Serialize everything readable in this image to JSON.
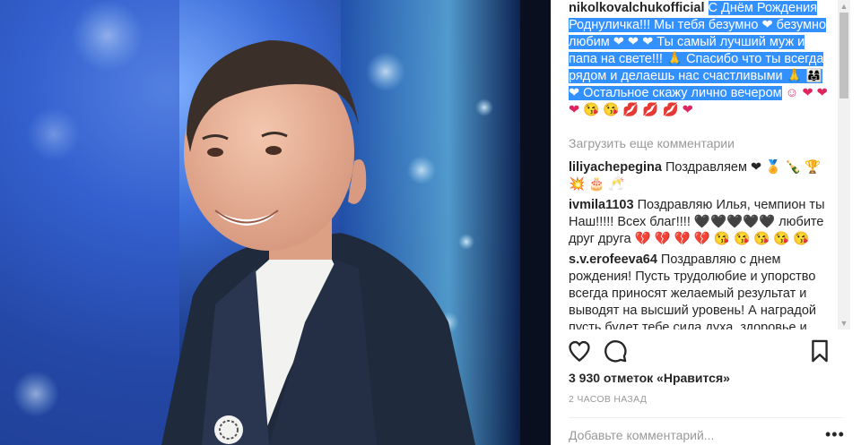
{
  "post": {
    "author": "nikolkovalchukofficial",
    "caption_selected": "С Днём Рождения Роднуличка!!! Мы тебя безумно ❤ безумно любим ❤ ❤ ❤ Ты самый лучший муж и папа на свете!!! 🙏 Спасибо что ты всегда рядом и делаешь нас счастливыми 🙏 👨‍👩‍👧 ❤ Остальное скажу лично вечером",
    "caption_tail": "☺ ❤ ❤ ❤ 😘 😘 💋 💋 💋 ❤"
  },
  "load_more": "Загрузить еще комментарии",
  "comments": [
    {
      "user": "liliyachepegina",
      "text": "Поздравляем ❤ 🏅 🍾 🏆 💥 🎂 🥂"
    },
    {
      "user": "ivmila1103",
      "text": "Поздравляю Илья, чемпион ты Наш!!!!! Всех благ!!!! 🖤🖤🖤🖤🖤 любите друг друга 💔 💔 💔 💔 😘 😘 😘 😘 😘"
    },
    {
      "user": "s.v.erofeeva64",
      "text": "Поздравляю с днем рождения! Пусть трудолюбие и упорство всегда приносят желаемый результат и выводят на высший уровень! А наградой пусть будет тебе сила духа ,здоровье и"
    }
  ],
  "likes": "3 930 отметок «Нравится»",
  "timestamp": "2 ЧАСОВ НАЗАД",
  "add_comment_placeholder": "Добавьте комментарий...",
  "more_label": "•••",
  "icons": {
    "like": "heart-icon",
    "comment": "comment-bubble-icon",
    "save": "bookmark-icon",
    "more": "more-options-icon",
    "scroll_up": "scroll-up-arrow-icon",
    "scroll_down": "scroll-down-arrow-icon"
  }
}
